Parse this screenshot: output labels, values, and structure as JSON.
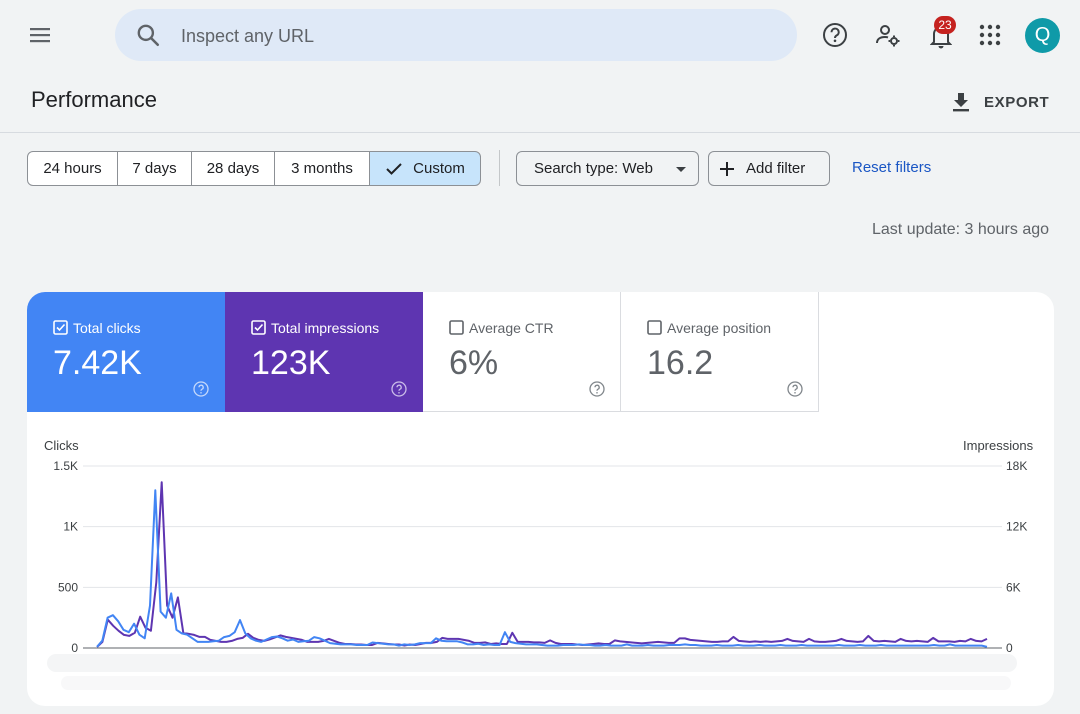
{
  "topbar": {
    "menu_icon": "menu-icon",
    "search_placeholder": "Inspect any URL",
    "notifications_count": "23",
    "avatar_letter": "Q"
  },
  "header": {
    "title": "Performance",
    "export_label": "EXPORT"
  },
  "filters": {
    "ranges": [
      "24 hours",
      "7 days",
      "28 days",
      "3 months",
      "Custom"
    ],
    "active_range": "Custom",
    "search_type": "Search type: Web",
    "add_filter": "Add filter",
    "reset": "Reset filters",
    "last_update": "Last update: 3 hours ago"
  },
  "metrics": [
    {
      "label": "Total clicks",
      "value": "7.42K",
      "checked": true,
      "color": "#4285f4"
    },
    {
      "label": "Total impressions",
      "value": "123K",
      "checked": true,
      "color": "#5e35b1"
    },
    {
      "label": "Average CTR",
      "value": "6%",
      "checked": false
    },
    {
      "label": "Average position",
      "value": "16.2",
      "checked": false
    }
  ],
  "chart_data": {
    "type": "line",
    "ylabel_left": "Clicks",
    "ylabel_right": "Impressions",
    "left_ticks": [
      "0",
      "500",
      "1K",
      "1.5K"
    ],
    "right_ticks": [
      "0",
      "6K",
      "12K",
      "18K"
    ],
    "ylim_left": [
      0,
      1500
    ],
    "ylim_right": [
      0,
      18000
    ],
    "grid": true,
    "series": [
      {
        "name": "Total clicks",
        "axis": "left",
        "color": "#4285f4",
        "values": [
          10,
          60,
          250,
          270,
          220,
          150,
          130,
          200,
          110,
          80,
          350,
          1300,
          300,
          250,
          450,
          150,
          120,
          110,
          80,
          50,
          50,
          50,
          55,
          60,
          90,
          100,
          130,
          230,
          120,
          80,
          60,
          50,
          70,
          90,
          95,
          80,
          60,
          70,
          50,
          55,
          60,
          90,
          80,
          60,
          40,
          35,
          30,
          30,
          30,
          25,
          25,
          25,
          45,
          40,
          35,
          30,
          30,
          20,
          30,
          25,
          30,
          40,
          40,
          40,
          80,
          60,
          55,
          55,
          55,
          45,
          30,
          30,
          35,
          25,
          30,
          25,
          25,
          130,
          50,
          40,
          35,
          30,
          30,
          30,
          25,
          20,
          20,
          20,
          25,
          25,
          25,
          30,
          25,
          25,
          20,
          20,
          25,
          20,
          20,
          20,
          30,
          20,
          20,
          20,
          25,
          20,
          20,
          20,
          25,
          25,
          25,
          30,
          25,
          25,
          20,
          20,
          20,
          25,
          20,
          20,
          20,
          25,
          20,
          20,
          20,
          25,
          20,
          20,
          20,
          25,
          20,
          20,
          20,
          25,
          20,
          20,
          20,
          20,
          20,
          20,
          25,
          20,
          20,
          20,
          25,
          20,
          20,
          20,
          25,
          20,
          20,
          20,
          20,
          20,
          20,
          20,
          20,
          20,
          25,
          20,
          20,
          30,
          20,
          20,
          20,
          20,
          20,
          20,
          10
        ]
      },
      {
        "name": "Total impressions",
        "axis": "right",
        "color": "#5e35b1",
        "values": [
          100,
          600,
          2800,
          2200,
          1700,
          1300,
          1200,
          1500,
          3100,
          2000,
          1700,
          6500,
          16400,
          4200,
          3000,
          5000,
          1500,
          1400,
          1300,
          1100,
          1100,
          800,
          700,
          600,
          600,
          700,
          900,
          1000,
          1400,
          1000,
          800,
          700,
          850,
          1050,
          1250,
          1100,
          1000,
          900,
          800,
          600,
          600,
          600,
          700,
          900,
          700,
          500,
          400,
          400,
          350,
          350,
          300,
          300,
          500,
          450,
          400,
          350,
          350,
          250,
          350,
          300,
          400,
          500,
          500,
          600,
          1000,
          900,
          900,
          900,
          800,
          700,
          500,
          500,
          550,
          400,
          450,
          400,
          400,
          1500,
          600,
          600,
          600,
          550,
          550,
          500,
          750,
          500,
          400,
          400,
          400,
          350,
          300,
          350,
          400,
          450,
          400,
          400,
          750,
          650,
          600,
          550,
          500,
          450,
          500,
          550,
          600,
          550,
          500,
          500,
          950,
          950,
          800,
          750,
          700,
          650,
          600,
          600,
          650,
          650,
          1100,
          700,
          650,
          600,
          650,
          600,
          650,
          600,
          650,
          700,
          900,
          700,
          650,
          600,
          900,
          650,
          600,
          600,
          650,
          700,
          900,
          700,
          650,
          600,
          650,
          1200,
          700,
          650,
          700,
          650,
          600,
          900,
          700,
          650,
          700,
          650,
          600,
          1000,
          650,
          650,
          650,
          600,
          700,
          650,
          900,
          700,
          650,
          900
        ]
      }
    ]
  }
}
